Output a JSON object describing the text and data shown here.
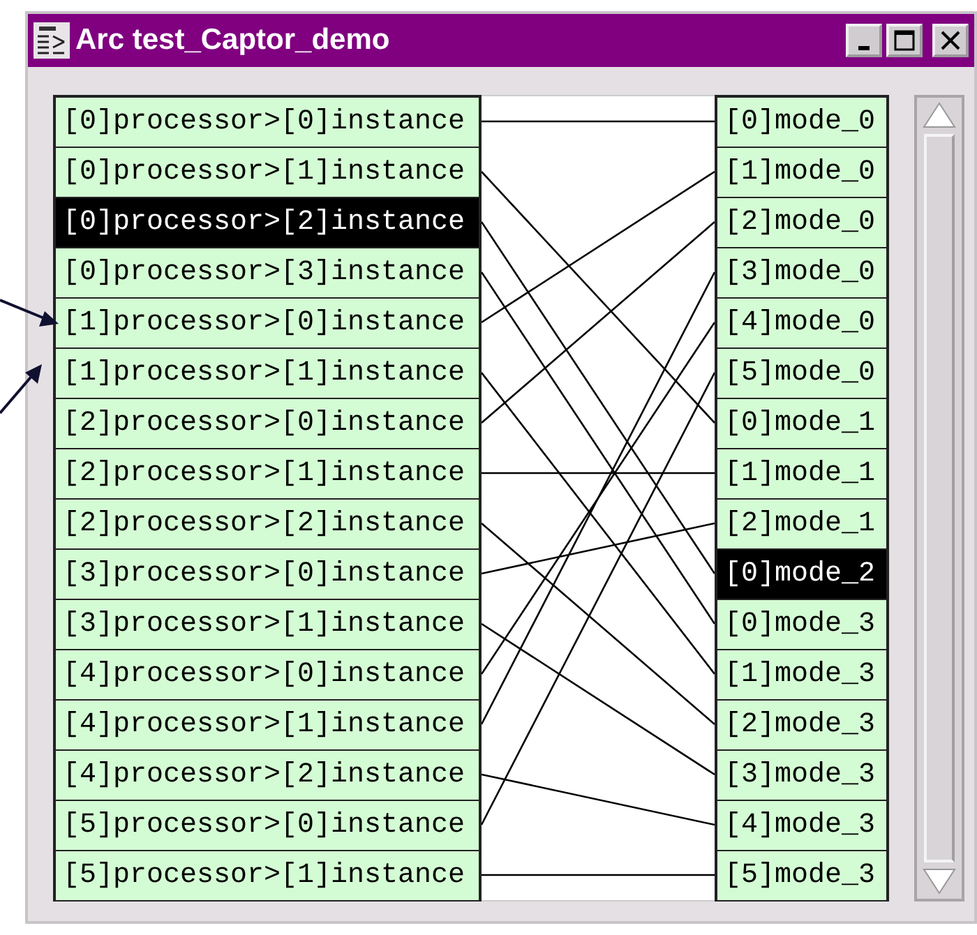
{
  "window": {
    "title": "Arc test_Captor_demo"
  },
  "left_items": [
    {
      "label": "[0]processor>[0]instance",
      "selected": false
    },
    {
      "label": "[0]processor>[1]instance",
      "selected": false
    },
    {
      "label": "[0]processor>[2]instance",
      "selected": true
    },
    {
      "label": "[0]processor>[3]instance",
      "selected": false
    },
    {
      "label": "[1]processor>[0]instance",
      "selected": false
    },
    {
      "label": "[1]processor>[1]instance",
      "selected": false
    },
    {
      "label": "[2]processor>[0]instance",
      "selected": false
    },
    {
      "label": "[2]processor>[1]instance",
      "selected": false
    },
    {
      "label": "[2]processor>[2]instance",
      "selected": false
    },
    {
      "label": "[3]processor>[0]instance",
      "selected": false
    },
    {
      "label": "[3]processor>[1]instance",
      "selected": false
    },
    {
      "label": "[4]processor>[0]instance",
      "selected": false
    },
    {
      "label": "[4]processor>[1]instance",
      "selected": false
    },
    {
      "label": "[4]processor>[2]instance",
      "selected": false
    },
    {
      "label": "[5]processor>[0]instance",
      "selected": false
    },
    {
      "label": "[5]processor>[1]instance",
      "selected": false
    }
  ],
  "right_items": [
    {
      "label": "[0]mode_0",
      "selected": false
    },
    {
      "label": "[1]mode_0",
      "selected": false
    },
    {
      "label": "[2]mode_0",
      "selected": false
    },
    {
      "label": "[3]mode_0",
      "selected": false
    },
    {
      "label": "[4]mode_0",
      "selected": false
    },
    {
      "label": "[5]mode_0",
      "selected": false
    },
    {
      "label": "[0]mode_1",
      "selected": false
    },
    {
      "label": "[1]mode_1",
      "selected": false
    },
    {
      "label": "[2]mode_1",
      "selected": false
    },
    {
      "label": "[0]mode_2",
      "selected": true
    },
    {
      "label": "[0]mode_3",
      "selected": false
    },
    {
      "label": "[1]mode_3",
      "selected": false
    },
    {
      "label": "[2]mode_3",
      "selected": false
    },
    {
      "label": "[3]mode_3",
      "selected": false
    },
    {
      "label": "[4]mode_3",
      "selected": false
    },
    {
      "label": "[5]mode_3",
      "selected": false
    }
  ]
}
